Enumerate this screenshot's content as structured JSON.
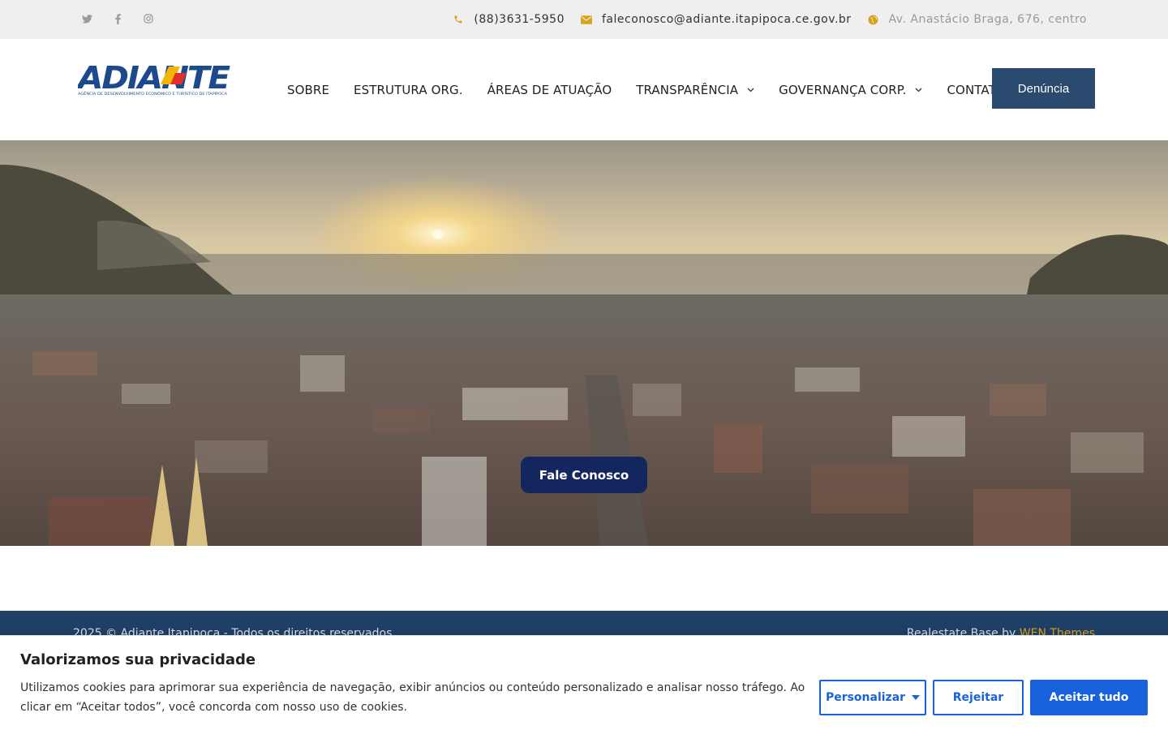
{
  "topbar": {
    "social": [
      {
        "icon": "twitter-icon",
        "glyph": "🐦"
      },
      {
        "icon": "facebook-icon",
        "glyph": "f"
      },
      {
        "icon": "instagram-icon",
        "glyph": "◎"
      }
    ],
    "phone": "(88)3631-5950",
    "email": "faleconosco@adiante.itapipoca.ce.gov.br",
    "address": "Av. Anastácio Braga, 676, centro"
  },
  "header": {
    "logo_text": "ADIANTE",
    "logo_subtitle": "AGÊNCIA DE DESENVOLVIMENTO ECONÔMICO E TURÍSTICO DE ITAPIPOCA",
    "nav": [
      {
        "label": "SOBRE",
        "dropdown": false
      },
      {
        "label": "ESTRUTURA ORG.",
        "dropdown": false
      },
      {
        "label": "ÁREAS DE ATUAÇÃO",
        "dropdown": false
      },
      {
        "label": "TRANSPARÊNCIA",
        "dropdown": true
      },
      {
        "label": "GOVERNANÇA CORP.",
        "dropdown": true
      },
      {
        "label": "CONTATO",
        "dropdown": false
      }
    ],
    "denuncia_label": "Denúncia"
  },
  "hero": {
    "cta_label": "Fale Conosco"
  },
  "footer": {
    "copyright": "2025 © Adiante Itapipoca - Todos os direitos reservados",
    "credit_prefix": "Realestate Base by ",
    "credit_link": "WEN Themes"
  },
  "cookie": {
    "title": "Valorizamos sua privacidade",
    "description": "Utilizamos cookies para aprimorar sua experiência de navegação, exibir anúncios ou conteúdo personalizado e analisar nosso tráfego. Ao clicar em “Aceitar todos”, você concorda com nosso uso de cookies.",
    "customize_label": "Personalizar",
    "reject_label": "Rejeitar",
    "accept_label": "Aceitar tudo"
  },
  "colors": {
    "accent_gold": "#d9a21b",
    "brand_blue": "#2b4a6f",
    "cookie_blue": "#1863dc",
    "footer_bg": "#1f3f66"
  }
}
